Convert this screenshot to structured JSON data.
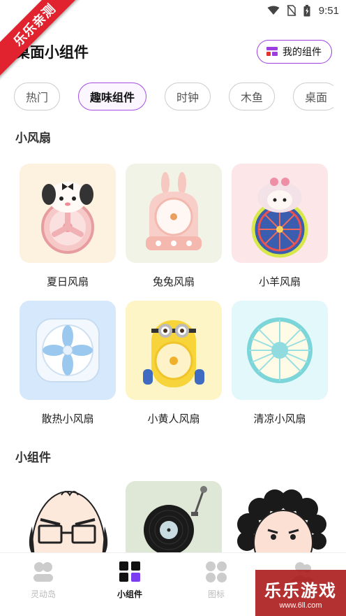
{
  "status_bar": {
    "time": "9:51",
    "icons": [
      "wifi-icon",
      "no-sim-icon",
      "battery-icon"
    ]
  },
  "ribbon": {
    "text": "乐乐亲测"
  },
  "header": {
    "title": "桌面小组件",
    "my_widgets_label": "我的组件"
  },
  "tabs": [
    {
      "label": "热门",
      "active": false
    },
    {
      "label": "趣味组件",
      "active": true
    },
    {
      "label": "时钟",
      "active": false
    },
    {
      "label": "木鱼",
      "active": false
    },
    {
      "label": "桌面",
      "active": false
    }
  ],
  "sections": {
    "fans": {
      "title": "小风扇",
      "items": [
        {
          "label": "夏日风扇",
          "bg": "#fdf1e0",
          "icon": "puppy-fan-icon"
        },
        {
          "label": "兔兔风扇",
          "bg": "#f1f3e6",
          "icon": "bunny-fan-icon"
        },
        {
          "label": "小羊风扇",
          "bg": "#fde6e8",
          "icon": "sheep-fan-icon"
        },
        {
          "label": "散热小风扇",
          "bg": "#d6e8fb",
          "icon": "cooling-fan-icon"
        },
        {
          "label": "小黄人风扇",
          "bg": "#fdf5c6",
          "icon": "minion-fan-icon"
        },
        {
          "label": "清凉小风扇",
          "bg": "#e3f8fb",
          "icon": "cool-fan-icon"
        }
      ]
    },
    "widgets": {
      "title": "小组件",
      "items": [
        {
          "bg": "#ffffff",
          "icon": "bald-man-widget-icon"
        },
        {
          "bg": "#dfe8d6",
          "icon": "record-player-widget-icon"
        },
        {
          "bg": "#ffffff",
          "icon": "curly-lady-widget-icon"
        }
      ]
    }
  },
  "bottom_nav": [
    {
      "label": "灵动岛",
      "active": false,
      "icon": "island-icon"
    },
    {
      "label": "小组件",
      "active": true,
      "icon": "widgets-grid-icon"
    },
    {
      "label": "图标",
      "active": false,
      "icon": "icons-grid-icon"
    },
    {
      "label": "",
      "active": false,
      "icon": "people-icon"
    }
  ],
  "watermark": {
    "title": "乐乐游戏",
    "url": "www.6ll.com"
  },
  "colors": {
    "accent": "#9b3fe0",
    "ribbon": "#e0232e"
  }
}
